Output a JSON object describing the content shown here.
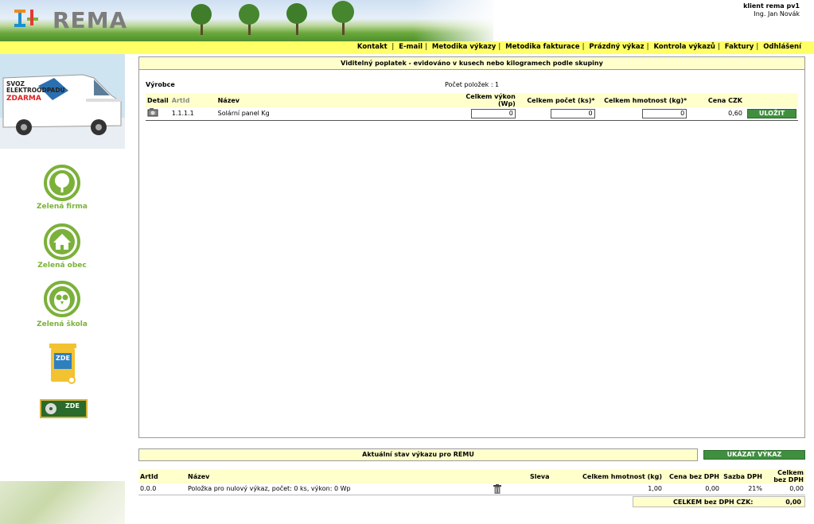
{
  "header": {
    "logo_text": "REMA",
    "user_line1": "klient rema pv1",
    "user_line2": "Ing. Jan Novák"
  },
  "topnav": {
    "items": [
      "Kontakt",
      "E-mail",
      "Metodika výkazy",
      "Metodika fakturace",
      "Prázdný výkaz",
      "Kontrola výkazů",
      "Faktury",
      "Odhlášení"
    ]
  },
  "sidebar": {
    "van_text1": "SVOZ",
    "van_text2": "ELEKTROODPADU",
    "van_text3": "ZDARMA",
    "logos": [
      {
        "caption": "Zelená firma"
      },
      {
        "caption": "Zelená obec"
      },
      {
        "caption": "Zelená škola"
      }
    ],
    "badge1": "ZDE",
    "badge2": "ZDE"
  },
  "main": {
    "title": "Viditelný poplatek - evidováno v kusech nebo kilogramech podle skupiny",
    "producer_label": "Výrobce",
    "count_label": "Počet položek : 1",
    "columns": [
      "Detail",
      "ArtId",
      "Název",
      "Celkem výkon (Wp)",
      "Celkem počet (ks)*",
      "Celkem hmotnost (kg)*",
      "Cena CZK"
    ],
    "rows": [
      {
        "art_id": "1.1.1.1",
        "name": "Solární panel Kg",
        "vykon": "0",
        "pocet": "0",
        "hmotnost": "0",
        "cena": "0,60",
        "save_label": "ULOŽIT"
      }
    ]
  },
  "report": {
    "title": "Aktuální stav výkazu pro REMU",
    "show_button": "UKÁZAT VÝKAZ",
    "columns": [
      "ArtId",
      "Název",
      "Sleva",
      "Celkem hmotnost (kg)",
      "Cena bez DPH",
      "Sazba DPH",
      "Celkem bez DPH"
    ],
    "rows": [
      {
        "art_id": "0.0.0",
        "name": "Položka pro nulový výkaz, počet: 0 ks, výkon: 0 Wp",
        "sleva": "",
        "hmotnost": "1,00",
        "cena": "0,00",
        "sazba": "21%",
        "celkem": "0,00"
      }
    ],
    "total_label": "CELKEM bez DPH CZK:",
    "total_value": "0,00"
  },
  "colors": {
    "accent_yellow": "#ffff66",
    "header_yellow": "#ffffcc",
    "button_green": "#3f8f3f",
    "brand_green": "#7bb13a"
  }
}
